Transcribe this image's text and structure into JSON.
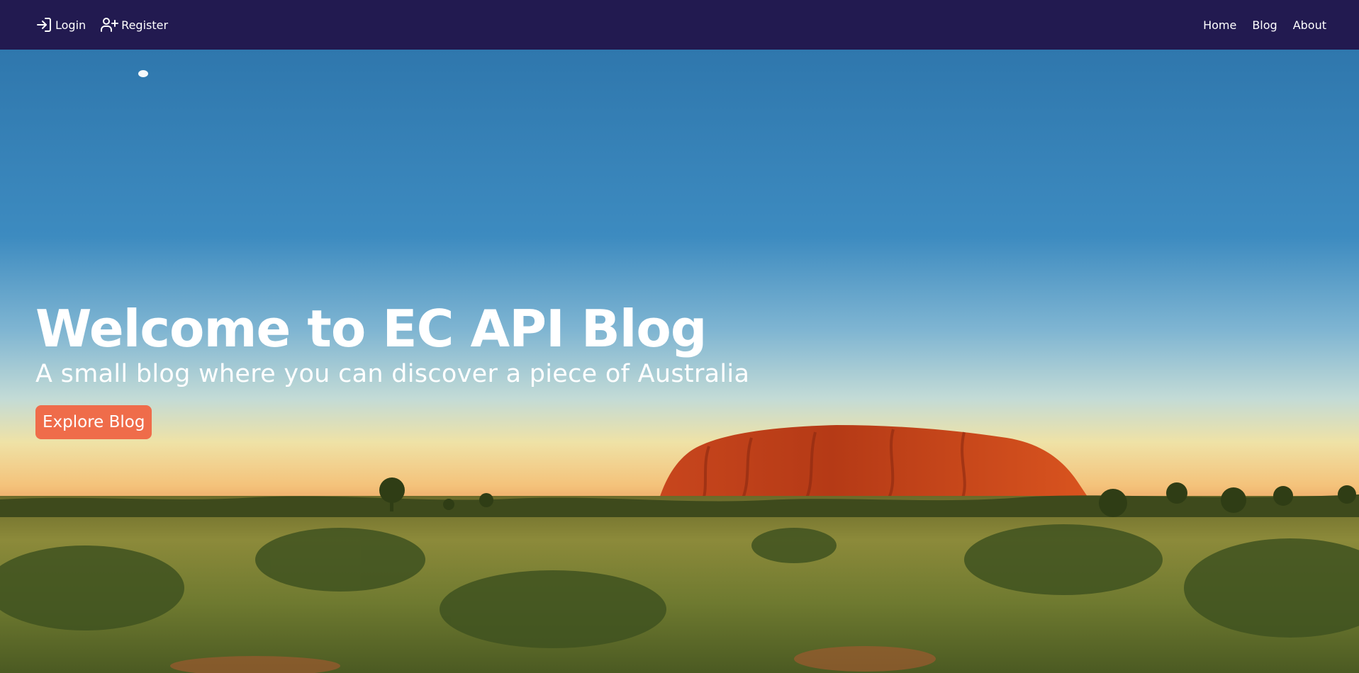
{
  "nav": {
    "login_label": "Login",
    "register_label": "Register",
    "home_label": "Home",
    "blog_label": "Blog",
    "about_label": "About",
    "login_icon": "login-icon",
    "register_icon": "user-plus-icon"
  },
  "hero": {
    "title": "Welcome to EC API Blog",
    "subtitle": "A small blog where you can discover a piece of Australia",
    "button_label": "Explore Blog"
  },
  "colors": {
    "navbar_bg": "#221a50",
    "button_bg": "#ef6c4a",
    "text": "#ffffff"
  }
}
